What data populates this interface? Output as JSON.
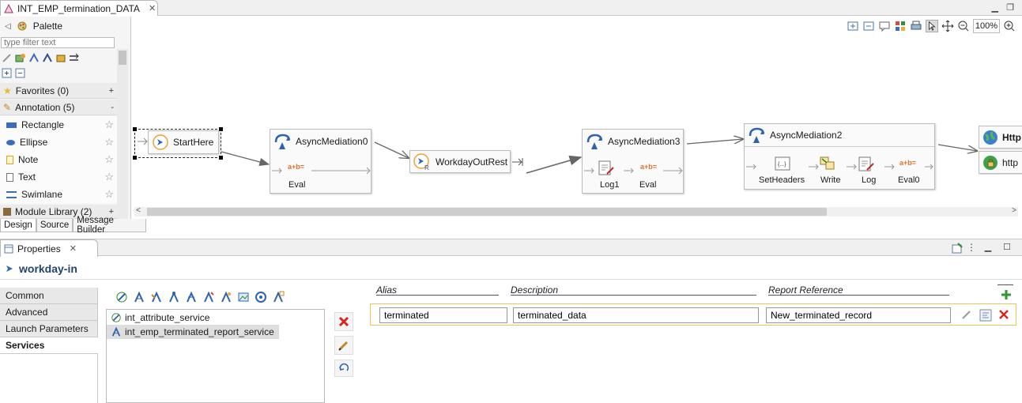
{
  "editor": {
    "tab_title": "INT_EMP_termination_DATA"
  },
  "palette": {
    "title": "Palette",
    "filter_placeholder": "type filter text",
    "drawers": [
      {
        "label": "Favorites (0)",
        "toggle": "+"
      },
      {
        "label": "Annotation (5)",
        "toggle": "-"
      },
      {
        "label": "Module Library (2)",
        "toggle": "+"
      }
    ],
    "items": [
      "Rectangle",
      "Ellipse",
      "Note",
      "Text",
      "Swimlane"
    ]
  },
  "mode_tabs": [
    "Design",
    "Source",
    "Message Builder"
  ],
  "canvas": {
    "zoom": "100%",
    "nodes": {
      "start": "StartHere",
      "async0": {
        "title": "AsyncMediation0",
        "steps": [
          "Eval"
        ]
      },
      "workday_out": "WorkdayOutRest",
      "async3": {
        "title": "AsyncMediation3",
        "steps": [
          "Log1",
          "Eval"
        ]
      },
      "async2": {
        "title": "AsyncMediation2",
        "steps": [
          "SetHeaders",
          "Write",
          "Log",
          "Eval0"
        ]
      },
      "http_partial": "Http",
      "http_partial2": "http"
    },
    "eval_glyph": "a+b="
  },
  "properties": {
    "tab_title": "Properties",
    "component_title": "workday-in",
    "left_tabs": [
      "Common",
      "Advanced",
      "Launch Parameters",
      "Services"
    ],
    "active_tab": "Services",
    "services": [
      "int_attribute_service",
      "int_emp_terminated_report_service"
    ],
    "columns": {
      "alias": "Alias",
      "description": "Description",
      "report_reference": "Report Reference"
    },
    "row": {
      "alias": "terminated",
      "description": "terminated_data",
      "report_reference": "New_terminated_record"
    },
    "colors": {
      "delete": "#d9261c",
      "add": "#2e9a2e",
      "title": "#23436b"
    }
  }
}
